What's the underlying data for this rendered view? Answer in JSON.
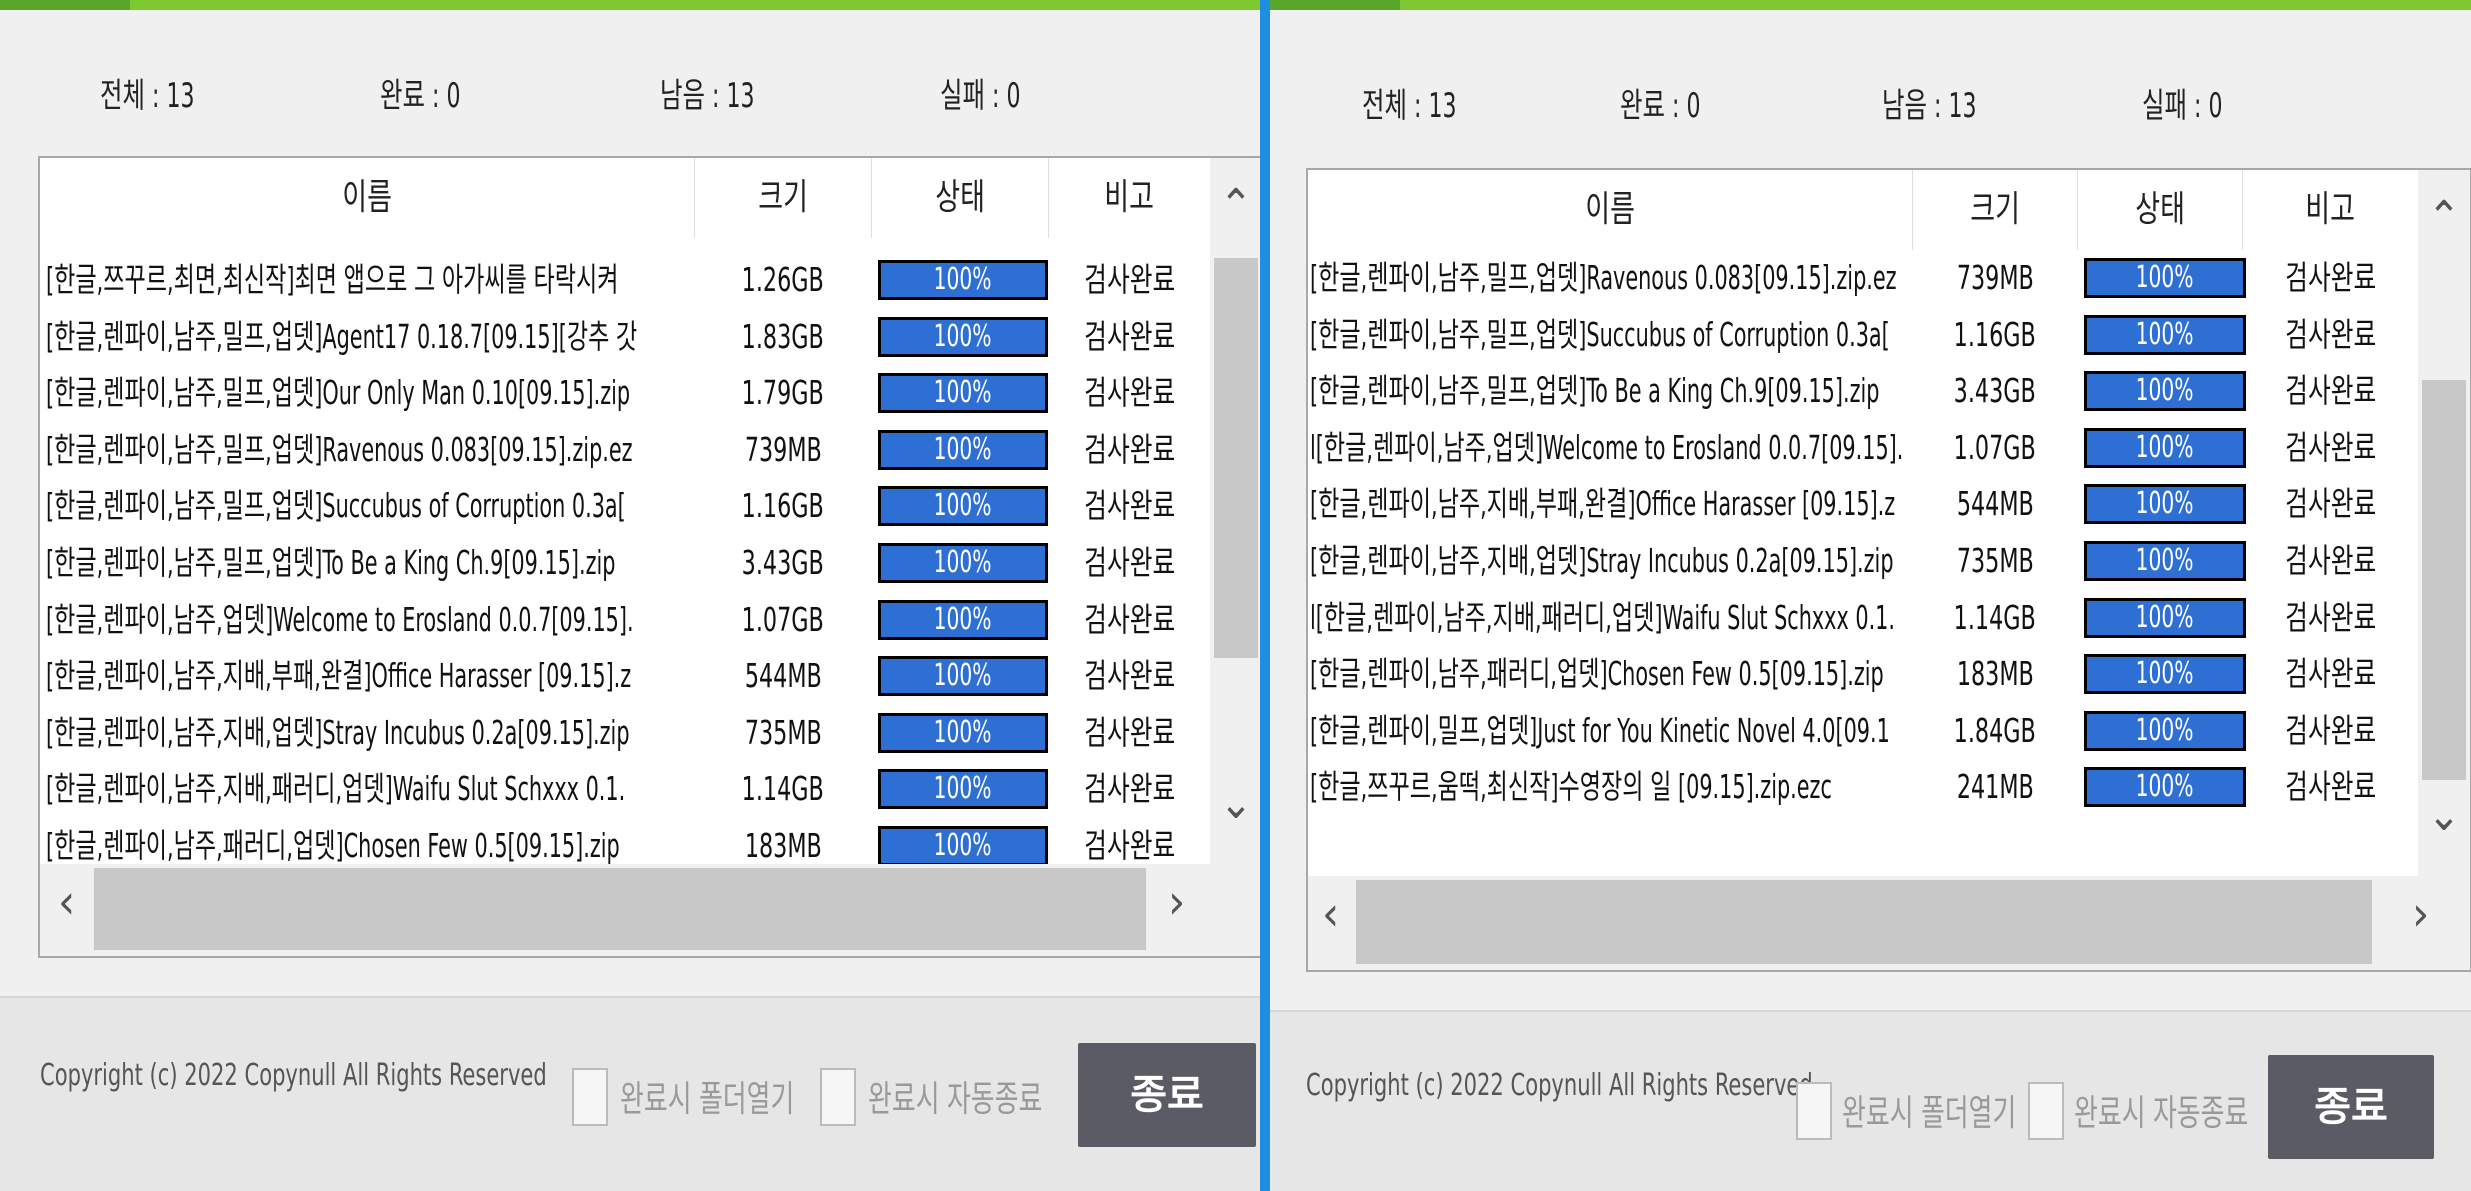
{
  "stats": {
    "total": "전체 : 13",
    "done": "완료 : 0",
    "remaining": "남음 : 13",
    "failed": "실패 : 0"
  },
  "columns": {
    "name": "이름",
    "size": "크기",
    "status": "상태",
    "note": "비고"
  },
  "left_rows": [
    {
      "name": "[한글,쯔꾸르,최면,최신작]최면 앱으로 그 아가씨를 타락시켜",
      "size": "1.26GB",
      "status": "100%",
      "note": "검사완료"
    },
    {
      "name": "[한글,렌파이,남주,밀프,업뎃]Agent17 0.18.7[09.15][강추 갓",
      "size": "1.83GB",
      "status": "100%",
      "note": "검사완료"
    },
    {
      "name": "[한글,렌파이,남주,밀프,업뎃]Our Only Man 0.10[09.15].zip",
      "size": "1.79GB",
      "status": "100%",
      "note": "검사완료"
    },
    {
      "name": "[한글,렌파이,남주,밀프,업뎃]Ravenous 0.083[09.15].zip.ez",
      "size": "739MB",
      "status": "100%",
      "note": "검사완료"
    },
    {
      "name": "[한글,렌파이,남주,밀프,업뎃]Succubus of Corruption 0.3a[",
      "size": "1.16GB",
      "status": "100%",
      "note": "검사완료"
    },
    {
      "name": "[한글,렌파이,남주,밀프,업뎃]To Be a King Ch.9[09.15].zip",
      "size": "3.43GB",
      "status": "100%",
      "note": "검사완료"
    },
    {
      "name": "[한글,렌파이,남주,업뎃]Welcome to Erosland 0.0.7[09.15].",
      "size": "1.07GB",
      "status": "100%",
      "note": "검사완료"
    },
    {
      "name": "[한글,렌파이,남주,지배,부패,완결]Office Harasser [09.15].z",
      "size": "544MB",
      "status": "100%",
      "note": "검사완료"
    },
    {
      "name": "[한글,렌파이,남주,지배,업뎃]Stray Incubus 0.2a[09.15].zip",
      "size": "735MB",
      "status": "100%",
      "note": "검사완료"
    },
    {
      "name": "[한글,렌파이,남주,지배,패러디,업뎃]Waifu Slut Schxxx 0.1.",
      "size": "1.14GB",
      "status": "100%",
      "note": "검사완료"
    },
    {
      "name": "[한글,렌파이,남주,패러디,업뎃]Chosen Few 0.5[09.15].zip",
      "size": "183MB",
      "status": "100%",
      "note": "검사완료"
    }
  ],
  "right_rows": [
    {
      "name": "[한글,렌파이,남주,밀프,업뎃]Ravenous 0.083[09.15].zip.ez",
      "size": "739MB",
      "status": "100%",
      "note": "검사완료"
    },
    {
      "name": "[한글,렌파이,남주,밀프,업뎃]Succubus of Corruption 0.3a[",
      "size": "1.16GB",
      "status": "100%",
      "note": "검사완료"
    },
    {
      "name": "[한글,렌파이,남주,밀프,업뎃]To Be a King Ch.9[09.15].zip",
      "size": "3.43GB",
      "status": "100%",
      "note": "검사완료"
    },
    {
      "name": "l[한글,렌파이,남주,업뎃]Welcome to Erosland 0.0.7[09.15].",
      "size": "1.07GB",
      "status": "100%",
      "note": "검사완료"
    },
    {
      "name": "[한글,렌파이,남주,지배,부패,완결]Office Harasser [09.15].z",
      "size": "544MB",
      "status": "100%",
      "note": "검사완료"
    },
    {
      "name": "[한글,렌파이,남주,지배,업뎃]Stray Incubus 0.2a[09.15].zip",
      "size": "735MB",
      "status": "100%",
      "note": "검사완료"
    },
    {
      "name": "l[한글,렌파이,남주,지배,패러디,업뎃]Waifu Slut Schxxx 0.1.",
      "size": "1.14GB",
      "status": "100%",
      "note": "검사완료"
    },
    {
      "name": "[한글,렌파이,남주,패러디,업뎃]Chosen Few 0.5[09.15].zip",
      "size": "183MB",
      "status": "100%",
      "note": "검사완료"
    },
    {
      "name": "[한글,렌파이,밀프,업뎃]Just for You Kinetic Novel 4.0[09.1",
      "size": "1.84GB",
      "status": "100%",
      "note": "검사완료"
    },
    {
      "name": "[한글,쯔꾸르,움떡,최신작]수영장의 일 [09.15].zip.ezc",
      "size": "241MB",
      "status": "100%",
      "note": "검사완료"
    }
  ],
  "footer": {
    "copyright": "Copyright (c) 2022 Copynull All Rights Reserved",
    "open_folder_label": "완료시 폴더열기",
    "auto_close_label": "완료시 자동종료",
    "exit_label": "종료"
  },
  "icons": {
    "scroll_up": "chevron-up-icon",
    "scroll_down": "chevron-down-icon",
    "scroll_left": "chevron-left-icon",
    "scroll_right": "chevron-right-icon"
  },
  "colors": {
    "progress_fill": "#2e6fd3",
    "accent_top": "#7ec832",
    "divider": "#1e8fe0",
    "exit_button": "#5b5b66"
  }
}
